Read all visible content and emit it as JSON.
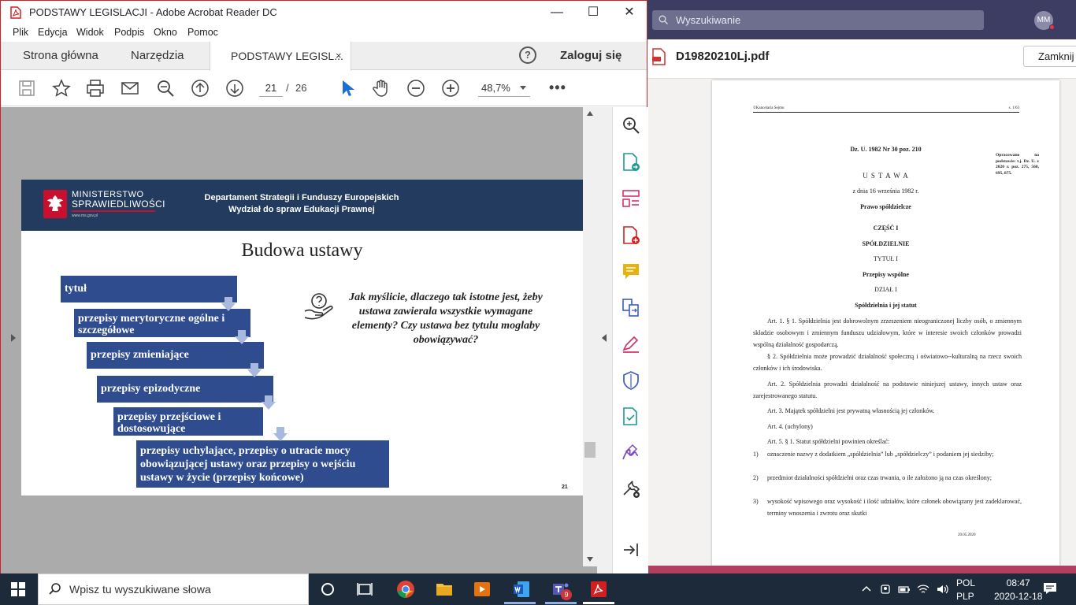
{
  "acrobat": {
    "title": "PODSTAWY LEGISLACJI - Adobe Acrobat Reader DC",
    "window_controls": {
      "minimize": "—",
      "maximize": "☐",
      "close": "✕"
    },
    "menu": [
      "Plik",
      "Edycja",
      "Widok",
      "Podpis",
      "Okno",
      "Pomoc"
    ],
    "tabs": {
      "home": "Strona główna",
      "tools": "Narzędzia",
      "document": "PODSTAWY LEGISL...",
      "close": "×"
    },
    "help_label": "?",
    "login_label": "Zaloguj się",
    "toolbar": {
      "page_current": "21",
      "page_sep": "/",
      "page_total": "26",
      "zoom": "48,7%",
      "more": "•••"
    },
    "icons": [
      "save-icon",
      "bookmark-star-icon",
      "print-icon",
      "email-icon",
      "search-zoom-icon",
      "page-up-icon",
      "page-down-icon",
      "select-cursor-icon",
      "hand-tool-icon",
      "zoom-out-icon",
      "zoom-in-icon"
    ],
    "right_tools": [
      "find-zoom-icon",
      "export-pdf-icon",
      "organize-pages-icon",
      "create-pdf-icon",
      "comment-icon",
      "combine-files-icon",
      "fill-sign-icon",
      "protect-icon",
      "send-for-review-icon",
      "sign-icon",
      "more-tools-icon",
      "collapse-panel-icon"
    ]
  },
  "slide": {
    "ministry_line1": "MINISTERSTWO",
    "ministry_line2": "SPRAWIEDLIWOŚCI",
    "ministry_url": "www.ms.gov.pl",
    "dept_line1": "Departament Strategii i Funduszy Europejskich",
    "dept_line2": "Wydział do spraw Edukacji Prawnej",
    "title": "Budowa ustawy",
    "boxes": [
      "tytuł",
      "przepisy merytoryczne ogólne i szczegółowe",
      "przepisy zmieniające",
      "przepisy epizodyczne",
      "przepisy przejściowe i dostosowujące",
      "przepisy uchylające, przepisy o utracie mocy obowiązującej ustawy oraz przepisy o wejściu ustawy w życie (przepisy końcowe)"
    ],
    "question": "Jak myślicie, dlaczego tak istotne jest, żeby ustawa zawierala wszystkie wymagane elementy? Czy ustawa bez tytulu moglaby obowiązywać?",
    "page_number": "21"
  },
  "right_app": {
    "search_placeholder": "Wyszukiwanie",
    "avatar": "MM",
    "file_name": "D19820210Lj.pdf",
    "close_button": "Zamknij",
    "pdf": {
      "header_left": "©Kancelaria Sejmu",
      "header_right": "s. 1/63",
      "dz": "Dz. U. 1982 Nr 30 poz. 210",
      "side_note": "Opracowano na podstawie: t.j. Dz. U. z 2020 r. poz. 275, 568, 695, 875.",
      "ustawa": "U S T A W A",
      "date": "z dnia 16 września 1982 r.",
      "law_title": "Prawo spółdzielcze",
      "part": "CZĘŚĆ I",
      "part_name": "SPÓŁDZIELNIE",
      "tytul": "TYTUŁ I",
      "tytul_name": "Przepisy wspólne",
      "dzial": "DZIAŁ I",
      "dzial_name": "Spółdzielnia i jej statut",
      "art1_p1": "Art. 1. § 1. Spółdzielnia jest dobrowolnym zrzeszeniem nieograniczonej liczby osób, o zmiennym składzie osobowym i zmiennym funduszu udziałowym, które w interesie swoich członków prowadzi wspólną działalność gospodarczą.",
      "art1_p2": "§ 2. Spółdzielnia może prowadzić działalność społeczną i oświatowo--kulturalną na rzecz swoich członków i ich środowiska.",
      "art2": "Art. 2. Spółdzielnia prowadzi działalność na podstawie niniejszej ustawy, innych ustaw oraz zarejestrowanego statutu.",
      "art3": "Art. 3. Majątek spółdzielni jest prywatną własnością jej członków.",
      "art4": "Art. 4. (uchylony)",
      "art5": "Art. 5. § 1. Statut spółdzielni powinien określać:",
      "item1": "oznaczenie nazwy z dodatkiem „spółdzielnia” lub „spółdzielczy” i podaniem jej siedziby;",
      "item2": "przedmiot działalności spółdzielni oraz czas trwania, o ile założono ją na czas określony;",
      "item3": "wysokość wpisowego oraz wysokość i ilość udziałów, które członek obowiązany jest zadeklarować, terminy wnoszenia i zwrotu oraz skutki",
      "item_nums": [
        "1)",
        "2)",
        "3)"
      ],
      "footer_date": "20.05.2020"
    }
  },
  "taskbar": {
    "search_placeholder": "Wpisz tu wyszukiwane słowa",
    "lang1": "POL",
    "lang2": "PLP",
    "time": "08:47",
    "date": "2020-12-18",
    "teams_badge": "9"
  },
  "colors": {
    "slide_box": "#2f4c8f",
    "banner": "#233b5e",
    "acrobat_red": "#d02020",
    "teams_top": "#3d3d63"
  }
}
